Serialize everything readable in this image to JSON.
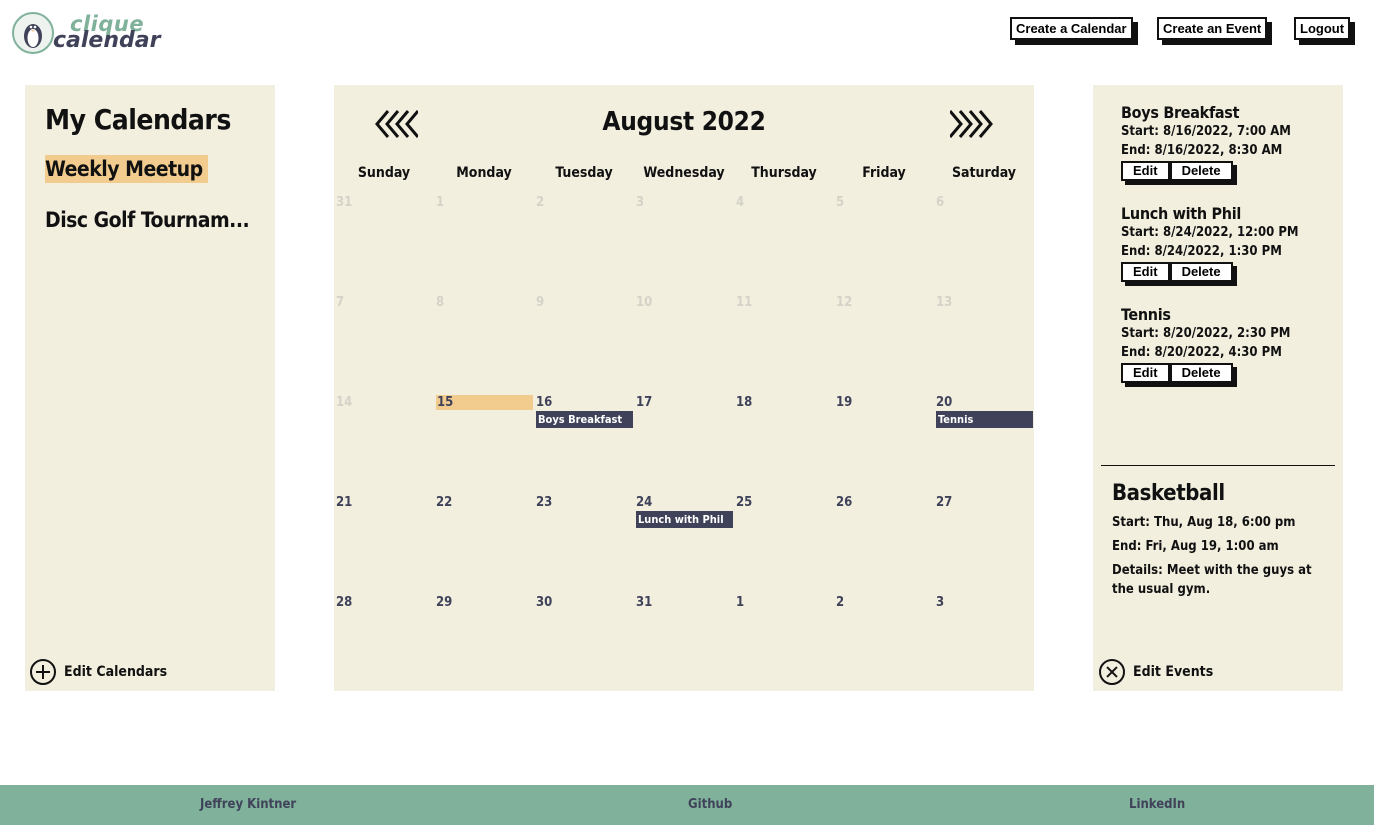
{
  "brand": {
    "word1": "clique",
    "word2": "calendar"
  },
  "header": {
    "create_calendar": "Create a Calendar",
    "create_event": "Create an Event",
    "logout": "Logout"
  },
  "sidebar": {
    "title": "My Calendars",
    "calendars": [
      {
        "label": "Weekly Meetup",
        "active": true
      },
      {
        "label": "Disc Golf Tournam...",
        "active": false
      }
    ],
    "edit_label": "Edit Calendars"
  },
  "calendar": {
    "month_label": "August 2022",
    "weekdays": [
      "Sunday",
      "Monday",
      "Tuesday",
      "Wednesday",
      "Thursday",
      "Friday",
      "Saturday"
    ],
    "weeks": [
      [
        {
          "d": "31",
          "muted": true
        },
        {
          "d": "1",
          "muted": true
        },
        {
          "d": "2",
          "muted": true
        },
        {
          "d": "3",
          "muted": true
        },
        {
          "d": "4",
          "muted": true
        },
        {
          "d": "5",
          "muted": true
        },
        {
          "d": "6",
          "muted": true
        }
      ],
      [
        {
          "d": "7",
          "muted": true
        },
        {
          "d": "8",
          "muted": true
        },
        {
          "d": "9",
          "muted": true
        },
        {
          "d": "10",
          "muted": true
        },
        {
          "d": "11",
          "muted": true
        },
        {
          "d": "12",
          "muted": true
        },
        {
          "d": "13",
          "muted": true
        }
      ],
      [
        {
          "d": "14",
          "muted": true
        },
        {
          "d": "15",
          "today": true
        },
        {
          "d": "16",
          "event": "Boys Breakfast"
        },
        {
          "d": "17"
        },
        {
          "d": "18"
        },
        {
          "d": "19"
        },
        {
          "d": "20",
          "event": "Tennis"
        }
      ],
      [
        {
          "d": "21"
        },
        {
          "d": "22"
        },
        {
          "d": "23"
        },
        {
          "d": "24",
          "event": "Lunch with Phil"
        },
        {
          "d": "25"
        },
        {
          "d": "26"
        },
        {
          "d": "27"
        }
      ],
      [
        {
          "d": "28"
        },
        {
          "d": "29"
        },
        {
          "d": "30"
        },
        {
          "d": "31"
        },
        {
          "d": "1"
        },
        {
          "d": "2"
        },
        {
          "d": "3"
        }
      ]
    ]
  },
  "events_panel": {
    "events": [
      {
        "name": "Boys Breakfast",
        "start": "Start: 8/16/2022, 7:00 AM",
        "end": "End: 8/16/2022, 8:30 AM"
      },
      {
        "name": "Lunch with Phil",
        "start": "Start: 8/24/2022, 12:00 PM",
        "end": "End: 8/24/2022, 1:30 PM"
      },
      {
        "name": "Tennis",
        "start": "Start: 8/20/2022, 2:30 PM",
        "end": "End: 8/20/2022, 4:30 PM"
      }
    ],
    "edit_button": "Edit",
    "delete_button": "Delete",
    "detail": {
      "title": "Basketball",
      "start": "Start: Thu, Aug 18, 6:00 pm",
      "end": "End: Fri, Aug 19, 1:00 am",
      "details": "Details: Meet with the guys at the usual gym."
    },
    "edit_label": "Edit Events"
  },
  "footer": {
    "name": "Jeffrey Kintner",
    "github": "Github",
    "linkedin": "LinkedIn"
  },
  "colors": {
    "panel": "#f2efdf",
    "accent": "#f2cc8f",
    "navy": "#3f4259",
    "green": "#80b29b"
  },
  "icons": {
    "logo": "penguin-icon",
    "prev": "double-chevron-left-icon",
    "next": "double-chevron-right-icon",
    "add": "plus-circle-icon",
    "close": "close-circle-icon"
  }
}
